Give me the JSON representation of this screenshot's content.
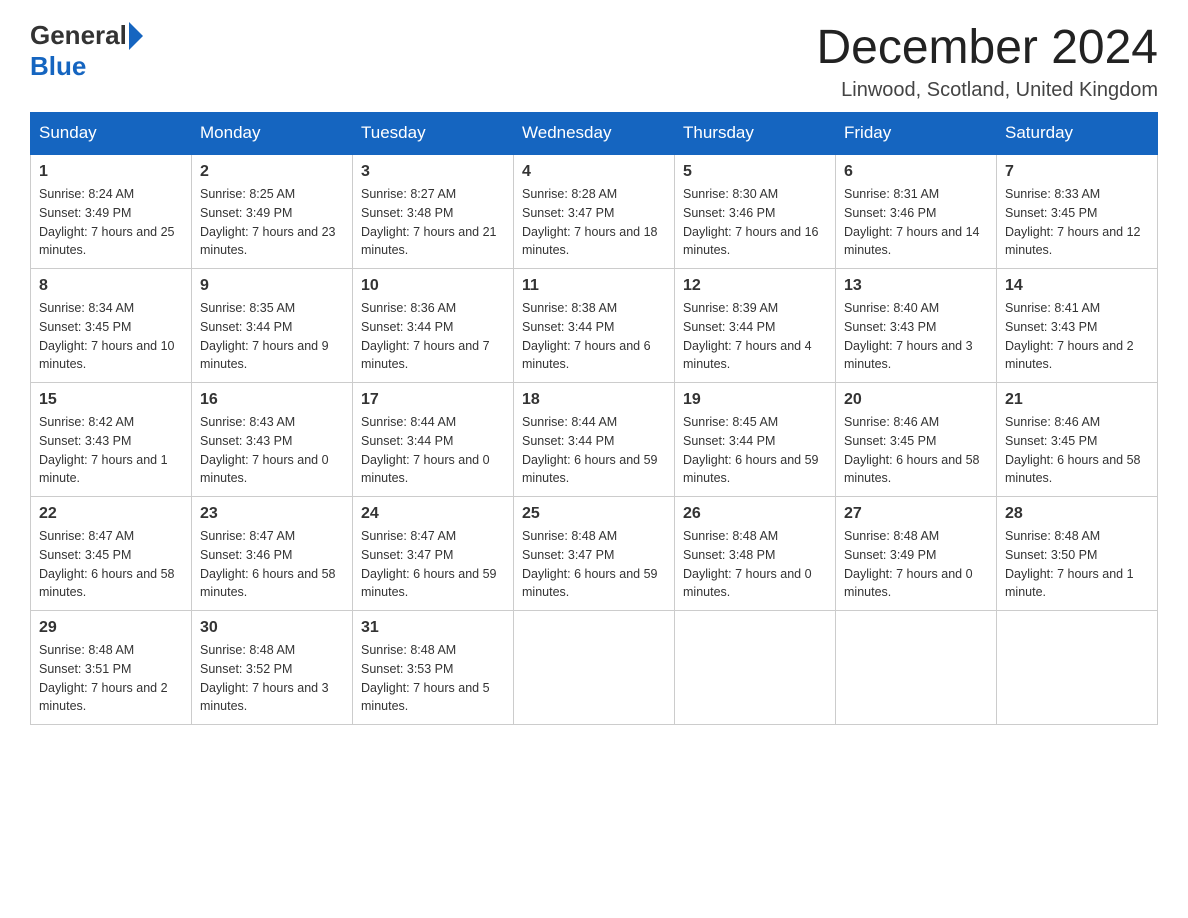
{
  "logo": {
    "text_general": "General",
    "text_blue": "Blue"
  },
  "header": {
    "month_title": "December 2024",
    "location": "Linwood, Scotland, United Kingdom"
  },
  "days_of_week": [
    "Sunday",
    "Monday",
    "Tuesday",
    "Wednesday",
    "Thursday",
    "Friday",
    "Saturday"
  ],
  "weeks": [
    [
      {
        "day": "1",
        "sunrise": "Sunrise: 8:24 AM",
        "sunset": "Sunset: 3:49 PM",
        "daylight": "Daylight: 7 hours and 25 minutes."
      },
      {
        "day": "2",
        "sunrise": "Sunrise: 8:25 AM",
        "sunset": "Sunset: 3:49 PM",
        "daylight": "Daylight: 7 hours and 23 minutes."
      },
      {
        "day": "3",
        "sunrise": "Sunrise: 8:27 AM",
        "sunset": "Sunset: 3:48 PM",
        "daylight": "Daylight: 7 hours and 21 minutes."
      },
      {
        "day": "4",
        "sunrise": "Sunrise: 8:28 AM",
        "sunset": "Sunset: 3:47 PM",
        "daylight": "Daylight: 7 hours and 18 minutes."
      },
      {
        "day": "5",
        "sunrise": "Sunrise: 8:30 AM",
        "sunset": "Sunset: 3:46 PM",
        "daylight": "Daylight: 7 hours and 16 minutes."
      },
      {
        "day": "6",
        "sunrise": "Sunrise: 8:31 AM",
        "sunset": "Sunset: 3:46 PM",
        "daylight": "Daylight: 7 hours and 14 minutes."
      },
      {
        "day": "7",
        "sunrise": "Sunrise: 8:33 AM",
        "sunset": "Sunset: 3:45 PM",
        "daylight": "Daylight: 7 hours and 12 minutes."
      }
    ],
    [
      {
        "day": "8",
        "sunrise": "Sunrise: 8:34 AM",
        "sunset": "Sunset: 3:45 PM",
        "daylight": "Daylight: 7 hours and 10 minutes."
      },
      {
        "day": "9",
        "sunrise": "Sunrise: 8:35 AM",
        "sunset": "Sunset: 3:44 PM",
        "daylight": "Daylight: 7 hours and 9 minutes."
      },
      {
        "day": "10",
        "sunrise": "Sunrise: 8:36 AM",
        "sunset": "Sunset: 3:44 PM",
        "daylight": "Daylight: 7 hours and 7 minutes."
      },
      {
        "day": "11",
        "sunrise": "Sunrise: 8:38 AM",
        "sunset": "Sunset: 3:44 PM",
        "daylight": "Daylight: 7 hours and 6 minutes."
      },
      {
        "day": "12",
        "sunrise": "Sunrise: 8:39 AM",
        "sunset": "Sunset: 3:44 PM",
        "daylight": "Daylight: 7 hours and 4 minutes."
      },
      {
        "day": "13",
        "sunrise": "Sunrise: 8:40 AM",
        "sunset": "Sunset: 3:43 PM",
        "daylight": "Daylight: 7 hours and 3 minutes."
      },
      {
        "day": "14",
        "sunrise": "Sunrise: 8:41 AM",
        "sunset": "Sunset: 3:43 PM",
        "daylight": "Daylight: 7 hours and 2 minutes."
      }
    ],
    [
      {
        "day": "15",
        "sunrise": "Sunrise: 8:42 AM",
        "sunset": "Sunset: 3:43 PM",
        "daylight": "Daylight: 7 hours and 1 minute."
      },
      {
        "day": "16",
        "sunrise": "Sunrise: 8:43 AM",
        "sunset": "Sunset: 3:43 PM",
        "daylight": "Daylight: 7 hours and 0 minutes."
      },
      {
        "day": "17",
        "sunrise": "Sunrise: 8:44 AM",
        "sunset": "Sunset: 3:44 PM",
        "daylight": "Daylight: 7 hours and 0 minutes."
      },
      {
        "day": "18",
        "sunrise": "Sunrise: 8:44 AM",
        "sunset": "Sunset: 3:44 PM",
        "daylight": "Daylight: 6 hours and 59 minutes."
      },
      {
        "day": "19",
        "sunrise": "Sunrise: 8:45 AM",
        "sunset": "Sunset: 3:44 PM",
        "daylight": "Daylight: 6 hours and 59 minutes."
      },
      {
        "day": "20",
        "sunrise": "Sunrise: 8:46 AM",
        "sunset": "Sunset: 3:45 PM",
        "daylight": "Daylight: 6 hours and 58 minutes."
      },
      {
        "day": "21",
        "sunrise": "Sunrise: 8:46 AM",
        "sunset": "Sunset: 3:45 PM",
        "daylight": "Daylight: 6 hours and 58 minutes."
      }
    ],
    [
      {
        "day": "22",
        "sunrise": "Sunrise: 8:47 AM",
        "sunset": "Sunset: 3:45 PM",
        "daylight": "Daylight: 6 hours and 58 minutes."
      },
      {
        "day": "23",
        "sunrise": "Sunrise: 8:47 AM",
        "sunset": "Sunset: 3:46 PM",
        "daylight": "Daylight: 6 hours and 58 minutes."
      },
      {
        "day": "24",
        "sunrise": "Sunrise: 8:47 AM",
        "sunset": "Sunset: 3:47 PM",
        "daylight": "Daylight: 6 hours and 59 minutes."
      },
      {
        "day": "25",
        "sunrise": "Sunrise: 8:48 AM",
        "sunset": "Sunset: 3:47 PM",
        "daylight": "Daylight: 6 hours and 59 minutes."
      },
      {
        "day": "26",
        "sunrise": "Sunrise: 8:48 AM",
        "sunset": "Sunset: 3:48 PM",
        "daylight": "Daylight: 7 hours and 0 minutes."
      },
      {
        "day": "27",
        "sunrise": "Sunrise: 8:48 AM",
        "sunset": "Sunset: 3:49 PM",
        "daylight": "Daylight: 7 hours and 0 minutes."
      },
      {
        "day": "28",
        "sunrise": "Sunrise: 8:48 AM",
        "sunset": "Sunset: 3:50 PM",
        "daylight": "Daylight: 7 hours and 1 minute."
      }
    ],
    [
      {
        "day": "29",
        "sunrise": "Sunrise: 8:48 AM",
        "sunset": "Sunset: 3:51 PM",
        "daylight": "Daylight: 7 hours and 2 minutes."
      },
      {
        "day": "30",
        "sunrise": "Sunrise: 8:48 AM",
        "sunset": "Sunset: 3:52 PM",
        "daylight": "Daylight: 7 hours and 3 minutes."
      },
      {
        "day": "31",
        "sunrise": "Sunrise: 8:48 AM",
        "sunset": "Sunset: 3:53 PM",
        "daylight": "Daylight: 7 hours and 5 minutes."
      },
      null,
      null,
      null,
      null
    ]
  ]
}
